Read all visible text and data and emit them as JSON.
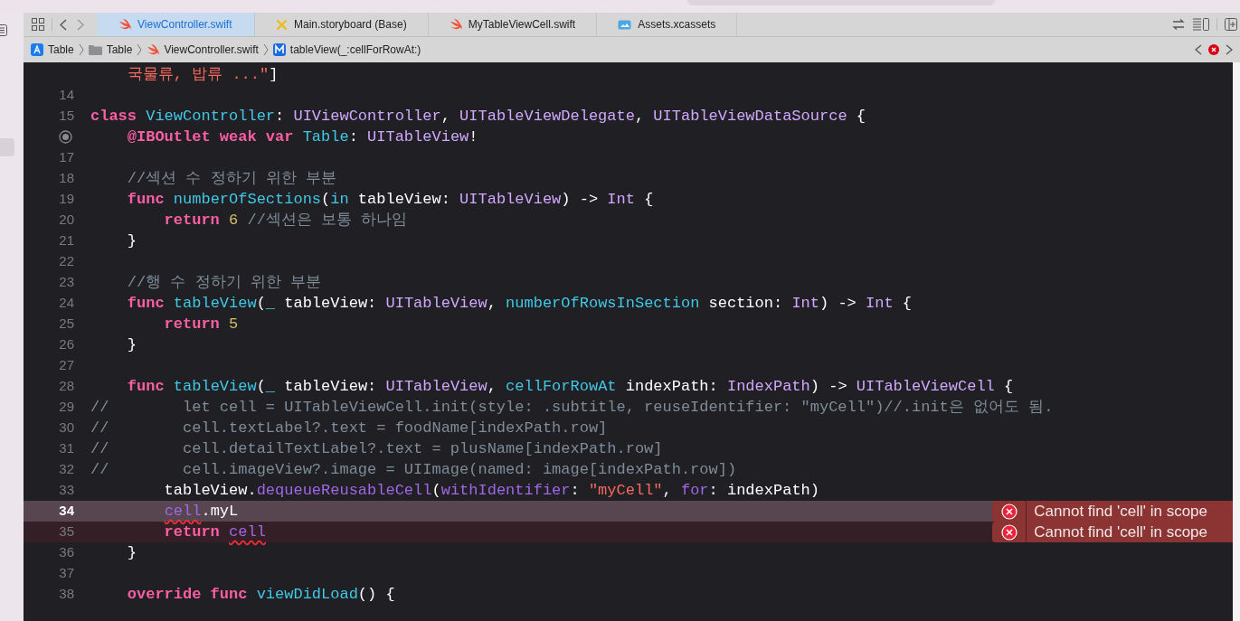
{
  "tabs": [
    {
      "label": "ViewController.swift",
      "kind": "swift",
      "selected": true
    },
    {
      "label": "Main.storyboard (Base)",
      "kind": "storyboard",
      "selected": false
    },
    {
      "label": "MyTableViewCell.swift",
      "kind": "swift",
      "selected": false
    },
    {
      "label": "Assets.xcassets",
      "kind": "assets",
      "selected": false
    }
  ],
  "breadcrumb": [
    {
      "label": "Table",
      "kind": "app"
    },
    {
      "label": "Table",
      "kind": "folder"
    },
    {
      "label": "ViewController.swift",
      "kind": "swift"
    },
    {
      "label": "tableView(_:cellForRowAt:)",
      "kind": "method"
    }
  ],
  "code_lines": [
    {
      "current": false,
      "tokens": [
        {
          "kind": "string",
          "text": "    국물류, 밥류 ...\""
        },
        {
          "kind": "plain",
          "text": "]"
        }
      ]
    },
    {
      "current": false,
      "number": "14"
    },
    {
      "current": false,
      "number": "15",
      "tokens": [
        {
          "kind": "keyword",
          "text": "class "
        },
        {
          "kind": "decl",
          "text": "ViewController"
        },
        {
          "kind": "plain",
          "text": ": "
        },
        {
          "kind": "type",
          "text": "UIViewController"
        },
        {
          "kind": "plain",
          "text": ", "
        },
        {
          "kind": "type",
          "text": "UITableViewDelegate"
        },
        {
          "kind": "plain",
          "text": ", "
        },
        {
          "kind": "type",
          "text": "UITableViewDataSource"
        },
        {
          "kind": "plain",
          "text": " {"
        }
      ]
    },
    {
      "current": false,
      "outlet": true,
      "tokens": [
        {
          "kind": "keyword",
          "text": "    @IBOutlet weak var "
        },
        {
          "kind": "decl",
          "text": "Table"
        },
        {
          "kind": "plain",
          "text": ": "
        },
        {
          "kind": "type",
          "text": "UITableView"
        },
        {
          "kind": "plain",
          "text": "!"
        }
      ]
    },
    {
      "current": false,
      "number": "17"
    },
    {
      "current": false,
      "number": "18",
      "tokens": [
        {
          "kind": "comment",
          "text": "    //섹션 수 정하기 위한 부분"
        }
      ]
    },
    {
      "current": false,
      "number": "19",
      "tokens": [
        {
          "kind": "keyword",
          "text": "    func "
        },
        {
          "kind": "decl",
          "text": "numberOfSections"
        },
        {
          "kind": "plain",
          "text": "("
        },
        {
          "kind": "decl",
          "text": "in"
        },
        {
          "kind": "plain",
          "text": " tableView: "
        },
        {
          "kind": "type",
          "text": "UITableView"
        },
        {
          "kind": "plain",
          "text": ") -> "
        },
        {
          "kind": "type",
          "text": "Int"
        },
        {
          "kind": "plain",
          "text": " {"
        }
      ]
    },
    {
      "current": false,
      "number": "20",
      "tokens": [
        {
          "kind": "keyword",
          "text": "        return "
        },
        {
          "kind": "number",
          "text": "6"
        },
        {
          "kind": "comment",
          "text": " //섹션은 보통 하나임"
        }
      ]
    },
    {
      "current": false,
      "number": "21",
      "tokens": [
        {
          "kind": "plain",
          "text": "    }"
        }
      ]
    },
    {
      "current": false,
      "number": "22"
    },
    {
      "current": false,
      "number": "23",
      "tokens": [
        {
          "kind": "comment",
          "text": "    //행 수 정하기 위한 부분"
        }
      ]
    },
    {
      "current": false,
      "number": "24",
      "tokens": [
        {
          "kind": "keyword",
          "text": "    func "
        },
        {
          "kind": "decl",
          "text": "tableView"
        },
        {
          "kind": "plain",
          "text": "("
        },
        {
          "kind": "decl",
          "text": "_"
        },
        {
          "kind": "plain",
          "text": " tableView: "
        },
        {
          "kind": "type",
          "text": "UITableView"
        },
        {
          "kind": "plain",
          "text": ", "
        },
        {
          "kind": "decl",
          "text": "numberOfRowsInSection"
        },
        {
          "kind": "plain",
          "text": " section: "
        },
        {
          "kind": "type",
          "text": "Int"
        },
        {
          "kind": "plain",
          "text": ") -> "
        },
        {
          "kind": "type",
          "text": "Int"
        },
        {
          "kind": "plain",
          "text": " {"
        }
      ]
    },
    {
      "current": false,
      "number": "25",
      "tokens": [
        {
          "kind": "keyword",
          "text": "        return "
        },
        {
          "kind": "number",
          "text": "5"
        }
      ]
    },
    {
      "current": false,
      "number": "26",
      "tokens": [
        {
          "kind": "plain",
          "text": "    }"
        }
      ]
    },
    {
      "current": false,
      "number": "27"
    },
    {
      "current": false,
      "number": "28",
      "tokens": [
        {
          "kind": "keyword",
          "text": "    func "
        },
        {
          "kind": "decl",
          "text": "tableView"
        },
        {
          "kind": "plain",
          "text": "("
        },
        {
          "kind": "decl",
          "text": "_"
        },
        {
          "kind": "plain",
          "text": " tableView: "
        },
        {
          "kind": "type",
          "text": "UITableView"
        },
        {
          "kind": "plain",
          "text": ", "
        },
        {
          "kind": "decl",
          "text": "cellForRowAt"
        },
        {
          "kind": "plain",
          "text": " indexPath: "
        },
        {
          "kind": "type",
          "text": "IndexPath"
        },
        {
          "kind": "plain",
          "text": ") -> "
        },
        {
          "kind": "type",
          "text": "UITableViewCell"
        },
        {
          "kind": "plain",
          "text": " {"
        }
      ]
    },
    {
      "current": false,
      "number": "29",
      "tokens": [
        {
          "kind": "comment",
          "text": "//        let cell = UITableViewCell.init(style: .subtitle, reuseIdentifier: \"myCell\")//.init은 없어도 됨."
        }
      ]
    },
    {
      "current": false,
      "number": "30",
      "tokens": [
        {
          "kind": "comment",
          "text": "//        cell.textLabel?.text = foodName[indexPath.row]"
        }
      ]
    },
    {
      "current": false,
      "number": "31",
      "tokens": [
        {
          "kind": "comment",
          "text": "//        cell.detailTextLabel?.text = plusName[indexPath.row]"
        }
      ]
    },
    {
      "current": false,
      "number": "32",
      "tokens": [
        {
          "kind": "comment",
          "text": "//        cell.imageView?.image = UIImage(named: image[indexPath.row])"
        }
      ]
    },
    {
      "current": false,
      "number": "33",
      "tokens": [
        {
          "kind": "plain",
          "text": "        tableView."
        },
        {
          "kind": "member",
          "text": "dequeueReusableCell"
        },
        {
          "kind": "plain",
          "text": "("
        },
        {
          "kind": "member",
          "text": "withIdentifier"
        },
        {
          "kind": "plain",
          "text": ": "
        },
        {
          "kind": "string",
          "text": "\"myCell\""
        },
        {
          "kind": "plain",
          "text": ", "
        },
        {
          "kind": "member",
          "text": "for"
        },
        {
          "kind": "plain",
          "text": ": indexPath)"
        }
      ]
    },
    {
      "current": true,
      "number": "34",
      "error": "Cannot find 'cell' in scope",
      "tokens": [
        {
          "kind": "member",
          "text": "        cell",
          "underlined": true
        },
        {
          "kind": "plain",
          "text": ".myL"
        }
      ]
    },
    {
      "current": false,
      "number": "35",
      "error": "Cannot find 'cell' in scope",
      "tokens": [
        {
          "kind": "keyword",
          "text": "        return "
        },
        {
          "kind": "member",
          "text": "cell",
          "underlined": true
        }
      ]
    },
    {
      "current": false,
      "number": "36",
      "tokens": [
        {
          "kind": "plain",
          "text": "    }"
        }
      ]
    },
    {
      "current": false,
      "number": "37"
    },
    {
      "current": false,
      "number": "38",
      "tokens": [
        {
          "kind": "keyword",
          "text": "    override func "
        },
        {
          "kind": "decl",
          "text": "viewDidLoad"
        },
        {
          "kind": "plain",
          "text": "() {"
        }
      ]
    }
  ]
}
